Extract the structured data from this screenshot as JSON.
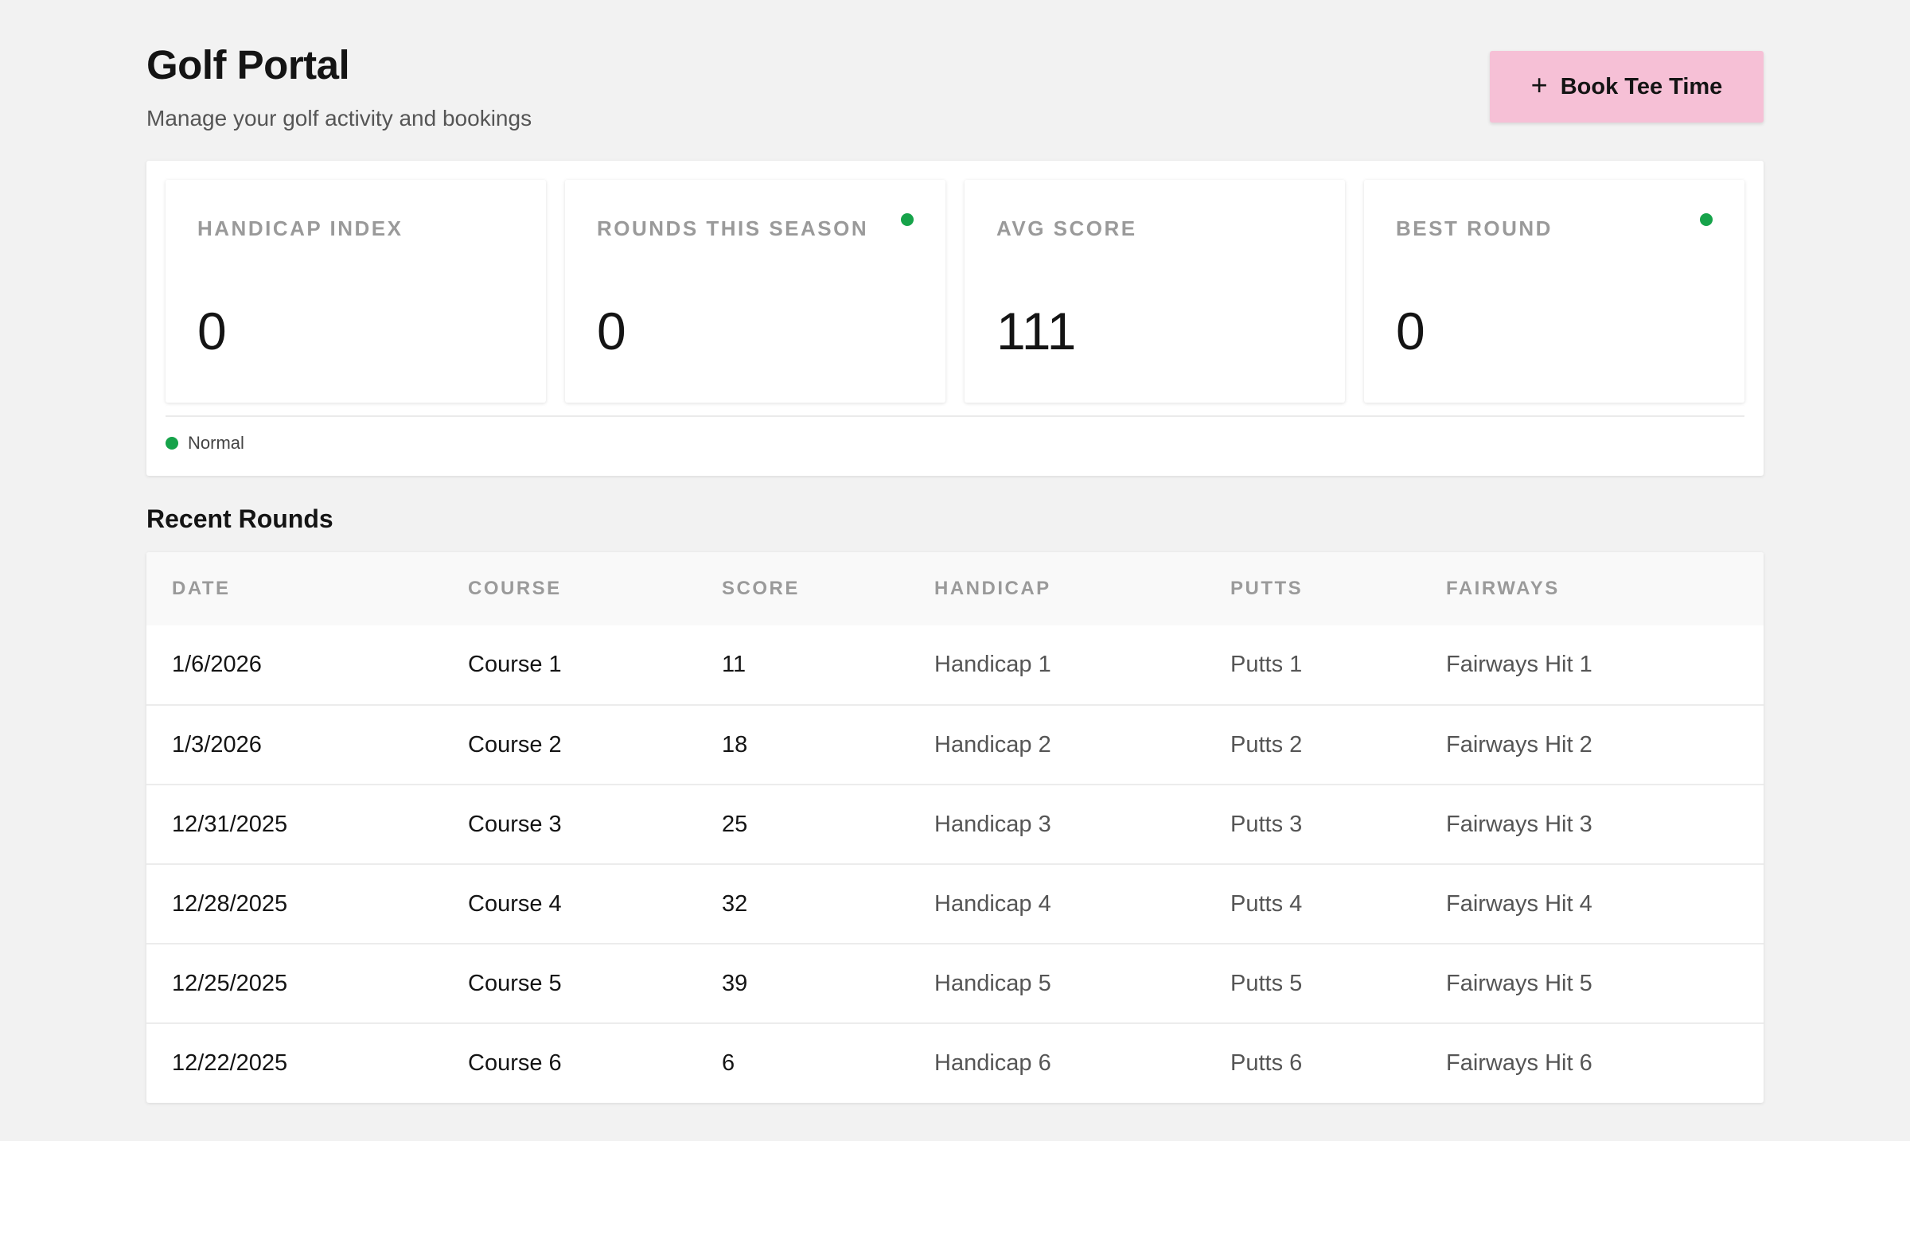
{
  "header": {
    "title": "Golf Portal",
    "subtitle": "Manage your golf activity and bookings",
    "book_button_label": "Book Tee Time",
    "book_button_icon": "plus-icon"
  },
  "stats": [
    {
      "label": "HANDICAP INDEX",
      "value": "0",
      "dot": false
    },
    {
      "label": "ROUNDS THIS SEASON",
      "value": "0",
      "dot": true
    },
    {
      "label": "AVG SCORE",
      "value": "111",
      "dot": false
    },
    {
      "label": "BEST ROUND",
      "value": "0",
      "dot": true
    }
  ],
  "legend": {
    "label": "Normal",
    "color": "#16a34a"
  },
  "recent_rounds": {
    "title": "Recent Rounds",
    "columns": [
      "DATE",
      "COURSE",
      "SCORE",
      "HANDICAP",
      "PUTTS",
      "FAIRWAYS"
    ],
    "rows": [
      [
        "1/6/2026",
        "Course 1",
        "11",
        "Handicap 1",
        "Putts 1",
        "Fairways Hit 1"
      ],
      [
        "1/3/2026",
        "Course 2",
        "18",
        "Handicap 2",
        "Putts 2",
        "Fairways Hit 2"
      ],
      [
        "12/31/2025",
        "Course 3",
        "25",
        "Handicap 3",
        "Putts 3",
        "Fairways Hit 3"
      ],
      [
        "12/28/2025",
        "Course 4",
        "32",
        "Handicap 4",
        "Putts 4",
        "Fairways Hit 4"
      ],
      [
        "12/25/2025",
        "Course 5",
        "39",
        "Handicap 5",
        "Putts 5",
        "Fairways Hit 5"
      ],
      [
        "12/22/2025",
        "Course 6",
        "6",
        "Handicap 6",
        "Putts 6",
        "Fairways Hit 6"
      ]
    ]
  },
  "colors": {
    "accent_button": "#f6c0d6",
    "status_green": "#16a34a",
    "page_background": "#f2f2f2"
  }
}
